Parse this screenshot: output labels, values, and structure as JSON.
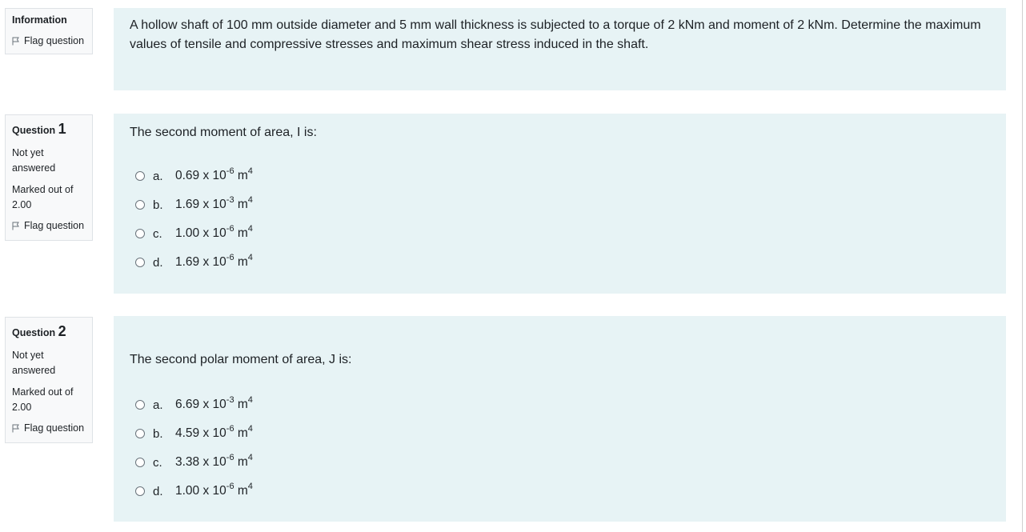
{
  "info": {
    "title": "Information",
    "flag_label": "Flag question",
    "text": "A hollow shaft of 100 mm outside diameter and 5 mm wall thickness is subjected to a torque of 2 kNm and moment of 2 kNm. Determine the maximum values of tensile and compressive stresses and maximum shear stress induced in the shaft."
  },
  "questions": [
    {
      "label": "Question",
      "number": "1",
      "status_1": "Not yet",
      "status_2": "answered",
      "marked_1": "Marked out of",
      "marked_2": "2.00",
      "flag_label": "Flag question",
      "text": "The second moment of area, I is:",
      "options": [
        {
          "letter": "a.",
          "base": "0.69 x 10",
          "exp": "-6",
          "unit": " m",
          "unit_exp": "4"
        },
        {
          "letter": "b.",
          "base": "1.69 x 10",
          "exp": "-3",
          "unit": " m",
          "unit_exp": "4"
        },
        {
          "letter": "c.",
          "base": "1.00 x 10",
          "exp": "-6",
          "unit": " m",
          "unit_exp": "4"
        },
        {
          "letter": "d.",
          "base": "1.69 x 10",
          "exp": "-6",
          "unit": " m",
          "unit_exp": "4"
        }
      ]
    },
    {
      "label": "Question",
      "number": "2",
      "status_1": "Not yet",
      "status_2": "answered",
      "marked_1": "Marked out of",
      "marked_2": "2.00",
      "flag_label": "Flag question",
      "text": "The second polar moment of area, J is:",
      "options": [
        {
          "letter": "a.",
          "base": "6.69 x 10",
          "exp": "-3",
          "unit": " m",
          "unit_exp": "4"
        },
        {
          "letter": "b.",
          "base": "4.59 x 10",
          "exp": "-6",
          "unit": " m",
          "unit_exp": "4"
        },
        {
          "letter": "c.",
          "base": "3.38 x 10",
          "exp": "-6",
          "unit": " m",
          "unit_exp": "4"
        },
        {
          "letter": "d.",
          "base": "1.00 x 10",
          "exp": "-6",
          "unit": " m",
          "unit_exp": "4"
        }
      ]
    }
  ]
}
